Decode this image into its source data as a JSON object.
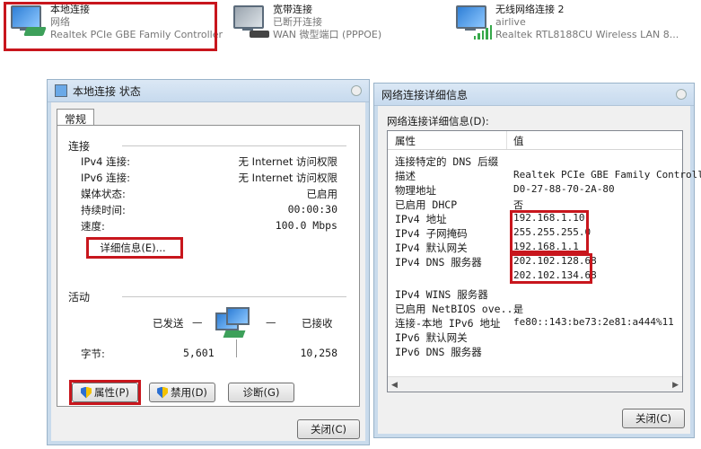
{
  "adapters": [
    {
      "name": "本地连接",
      "status": "网络",
      "device": "Realtek PCIe GBE Family Controller"
    },
    {
      "name": "宽带连接",
      "status": "已断开连接",
      "device": "WAN 微型端口 (PPPOE)"
    },
    {
      "name": "无线网络连接 2",
      "status": "airlive",
      "device": "Realtek RTL8188CU Wireless LAN 8..."
    }
  ],
  "status_dialog": {
    "title": "本地连接 状态",
    "tab": "常规",
    "connection_heading": "连接",
    "rows": [
      {
        "label": "IPv4 连接:",
        "value": "无 Internet 访问权限"
      },
      {
        "label": "IPv6 连接:",
        "value": "无 Internet 访问权限"
      },
      {
        "label": "媒体状态:",
        "value": "已启用"
      },
      {
        "label": "持续时间:",
        "value": "00:00:30"
      },
      {
        "label": "速度:",
        "value": "100.0 Mbps"
      }
    ],
    "details_button": "详细信息(E)...",
    "activity_heading": "活动",
    "sent_label": "已发送",
    "received_label": "已接收",
    "dash": "—",
    "bytes_label": "字节:",
    "bytes_sent": "5,601",
    "bytes_received": "10,258",
    "properties_button": "属性(P)",
    "disable_button": "禁用(D)",
    "diagnose_button": "诊断(G)",
    "close_button": "关闭(C)"
  },
  "details_dialog": {
    "title": "网络连接详细信息",
    "caption": "网络连接详细信息(D):",
    "col_property": "属性",
    "col_value": "值",
    "rows": [
      {
        "prop": "连接特定的 DNS 后缀",
        "value": ""
      },
      {
        "prop": "描述",
        "value": "Realtek PCIe GBE Family Controlle"
      },
      {
        "prop": "物理地址",
        "value": "D0-27-88-70-2A-80"
      },
      {
        "prop": "已启用 DHCP",
        "value": "否"
      },
      {
        "prop": "IPv4 地址",
        "value": "192.168.1.10"
      },
      {
        "prop": "IPv4 子网掩码",
        "value": "255.255.255.0"
      },
      {
        "prop": "IPv4 默认网关",
        "value": "192.168.1.1"
      },
      {
        "prop": "IPv4 DNS 服务器",
        "value": "202.102.128.68"
      },
      {
        "prop": "",
        "value": "202.102.134.68"
      },
      {
        "prop": "IPv4 WINS 服务器",
        "value": ""
      },
      {
        "prop": "已启用 NetBIOS ove...",
        "value": "是"
      },
      {
        "prop": "连接-本地 IPv6 地址",
        "value": "fe80::143:be73:2e81:a444%11"
      },
      {
        "prop": "IPv6 默认网关",
        "value": ""
      },
      {
        "prop": "IPv6 DNS 服务器",
        "value": ""
      }
    ],
    "close_button": "关闭(C)"
  },
  "colors": {
    "highlight": "#c8161d",
    "title_bar": "#c7daee",
    "dialog_bg": "#f0f0f0"
  }
}
